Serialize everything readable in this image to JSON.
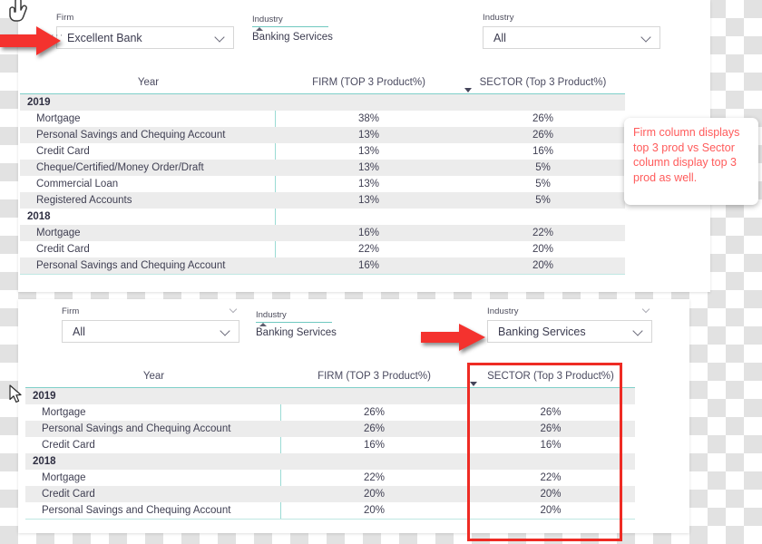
{
  "panels": [
    {
      "id": "top",
      "slicer_firm": {
        "label": "Firm",
        "value": "Excellent Bank",
        "handle_dots": "···",
        "icon": "chevron-down-icon"
      },
      "slicer_industry_list": {
        "label": "Industry",
        "items": [
          "Banking Services"
        ]
      },
      "slicer_industry_dropdown": {
        "label": "Industry",
        "value": "All",
        "icon": "chevron-down-icon"
      },
      "matrix": {
        "columns": [
          "Year",
          "FIRM (TOP 3 Product%)",
          "SECTOR (Top 3 Product%)"
        ],
        "sort_indicator": "sort-descending-icon",
        "rows": [
          {
            "type": "group",
            "label": "2019",
            "firm": "",
            "sector": ""
          },
          {
            "type": "item",
            "label": "Mortgage",
            "firm": "38%",
            "sector": "26%"
          },
          {
            "type": "item",
            "label": "Personal Savings and Chequing Account",
            "firm": "13%",
            "sector": "26%"
          },
          {
            "type": "item",
            "label": "Credit Card",
            "firm": "13%",
            "sector": "16%"
          },
          {
            "type": "item",
            "label": "Cheque/Certified/Money Order/Draft",
            "firm": "13%",
            "sector": "5%"
          },
          {
            "type": "item",
            "label": "Commercial Loan",
            "firm": "13%",
            "sector": "5%"
          },
          {
            "type": "item",
            "label": "Registered Accounts",
            "firm": "13%",
            "sector": "5%"
          },
          {
            "type": "group",
            "label": "2018",
            "firm": "",
            "sector": ""
          },
          {
            "type": "item",
            "label": "Mortgage",
            "firm": "16%",
            "sector": "22%"
          },
          {
            "type": "item",
            "label": "Credit Card",
            "firm": "22%",
            "sector": "20%"
          },
          {
            "type": "item",
            "label": "Personal Savings and Chequing Account",
            "firm": "16%",
            "sector": "20%"
          }
        ]
      }
    },
    {
      "id": "bottom",
      "slicer_firm": {
        "label": "Firm",
        "value": "All",
        "icon": "chevron-down-icon"
      },
      "slicer_industry_list": {
        "label": "Industry",
        "items": [
          "Banking Services"
        ]
      },
      "slicer_industry_dropdown": {
        "label": "Industry",
        "value": "Banking Services",
        "icon": "chevron-down-icon"
      },
      "matrix": {
        "columns": [
          "Year",
          "FIRM (TOP 3 Product%)",
          "SECTOR (Top 3 Product%)"
        ],
        "sort_indicator": "sort-descending-icon",
        "rows": [
          {
            "type": "group",
            "label": "2019",
            "firm": "",
            "sector": ""
          },
          {
            "type": "item",
            "label": "Mortgage",
            "firm": "26%",
            "sector": "26%"
          },
          {
            "type": "item",
            "label": "Personal Savings and Chequing Account",
            "firm": "26%",
            "sector": "26%"
          },
          {
            "type": "item",
            "label": "Credit Card",
            "firm": "16%",
            "sector": "16%"
          },
          {
            "type": "group",
            "label": "2018",
            "firm": "",
            "sector": ""
          },
          {
            "type": "item",
            "label": "Mortgage",
            "firm": "22%",
            "sector": "22%"
          },
          {
            "type": "item",
            "label": "Credit Card",
            "firm": "20%",
            "sector": "20%"
          },
          {
            "type": "item",
            "label": "Personal Savings and Chequing Account",
            "firm": "20%",
            "sector": "20%"
          }
        ]
      }
    }
  ],
  "annotations": {
    "callout_text": "Firm column displays top 3 prod vs Sector column display top 3 prod as well.",
    "arrow_top_name": "red-arrow-firm-slicer",
    "arrow_bottom_name": "red-arrow-industry-slicer",
    "highlight_name": "red-highlight-sector-column"
  },
  "colors": {
    "accent_teal": "#7fd0c9",
    "annotation_red": "#ee2b24",
    "callout_text_red": "#ff5b5b",
    "row_stripe": "#ececec",
    "text": "#3f3f52"
  },
  "cursors": {
    "top_left": "hand-pointer-cursor",
    "bottom_left": "arrow-cursor"
  }
}
